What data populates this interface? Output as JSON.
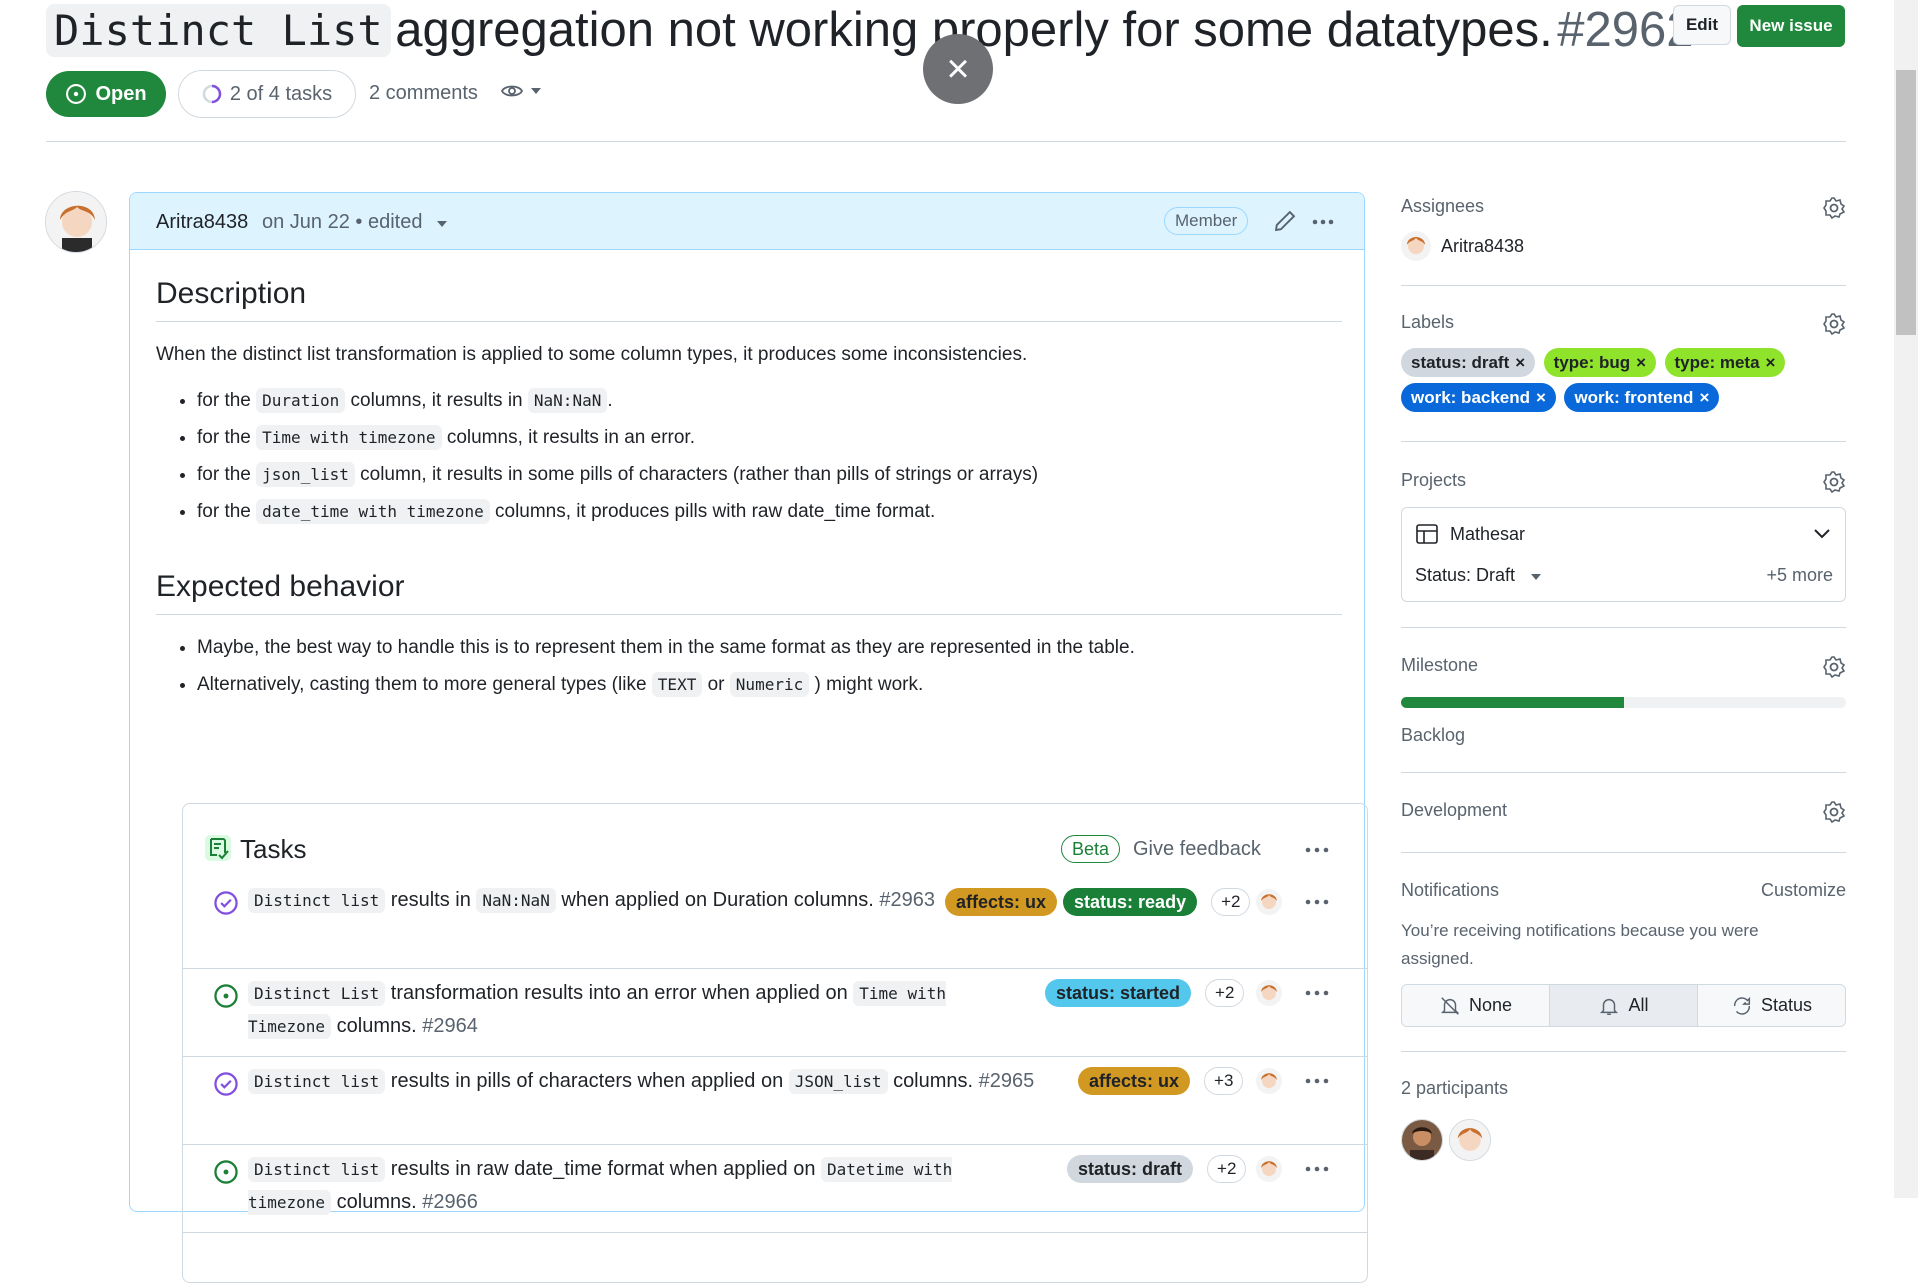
{
  "issue": {
    "title_code": "Distinct List",
    "title_rest": "aggregation not working properly for some datatypes.",
    "number": "#2962",
    "state": "Open",
    "tasks_progress": "2 of 4 tasks",
    "comments": "2 comments"
  },
  "toolbar": {
    "edit_label": "Edit",
    "new_issue_label": "New issue",
    "close_icon": "×"
  },
  "comment": {
    "author": "Aritra8438",
    "meta": "on Jun 22 • edited",
    "role": "Member",
    "description_heading": "Description",
    "description_text": "When the distinct list transformation is applied to some column types, it produces some inconsistencies.",
    "bullets": [
      {
        "pre": "for the",
        "code": "Duration",
        "mid": "columns, it results in",
        "code2": "NaN:NaN",
        "post": "."
      },
      {
        "pre": "for the",
        "code": "Time with timezone",
        "mid": "columns, it results in an error.",
        "code2": "",
        "post": ""
      },
      {
        "pre": "for the",
        "code": "json_list",
        "mid": "column, it results in some pills of characters (rather than pills of strings or arrays)",
        "code2": "",
        "post": ""
      },
      {
        "pre": "for the",
        "code": "date_time with timezone",
        "mid": "columns, it produces pills with raw date_time format.",
        "code2": "",
        "post": ""
      }
    ],
    "expected_heading": "Expected behavior",
    "expected": [
      {
        "text": "Maybe, the best way to handle this is to represent them in the same format as they are represented in the table."
      },
      {
        "pre": "Alternatively, casting them to more general types (like",
        "code": "TEXT",
        "mid": "or",
        "code2": "Numeric",
        "post": ") might work."
      }
    ]
  },
  "tasks": {
    "title": "Tasks",
    "beta": "Beta",
    "feedback": "Give feedback",
    "items": [
      {
        "code": "Distinct list",
        "text": "results in",
        "code2": "NaN:NaN",
        "text2": "when applied on Duration columns.",
        "num": "#2963",
        "state": "closed",
        "labels": [
          {
            "name": "affects: ux",
            "bg": "#d29922",
            "fg": "#1f2328"
          },
          {
            "name": "status: ready",
            "bg": "#1a7f37",
            "fg": "#ffffff"
          }
        ],
        "more": "+2"
      },
      {
        "code": "Distinct List",
        "text": "transformation results into an error when applied on",
        "code2": "Time with Timezone",
        "text2": "columns.",
        "num": "#2964",
        "state": "open",
        "labels": [
          {
            "name": "status: started",
            "bg": "#54c7ec",
            "fg": "#1f2328"
          }
        ],
        "more": "+2"
      },
      {
        "code": "Distinct list",
        "text": "results in pills of characters when applied on",
        "code2": "JSON_list",
        "text2": "columns.",
        "num": "#2965",
        "state": "closed",
        "labels": [
          {
            "name": "affects: ux",
            "bg": "#d29922",
            "fg": "#1f2328"
          }
        ],
        "more": "+3"
      },
      {
        "code": "Distinct list",
        "text": "results in raw date_time format when applied on",
        "code2": "Datetime with timezone",
        "text2": "columns.",
        "num": "#2966",
        "state": "open",
        "labels": [
          {
            "name": "status: draft",
            "bg": "#d0d7de",
            "fg": "#1f2328"
          }
        ],
        "more": "+2"
      }
    ]
  },
  "sidebar": {
    "assignees_heading": "Assignees",
    "assignee": "Aritra8438",
    "labels_heading": "Labels",
    "labels": [
      {
        "name": "status: draft",
        "bg": "#d0d7de",
        "fg": "#1f2328"
      },
      {
        "name": "type: bug",
        "bg": "#8fe32b",
        "fg": "#1f2328"
      },
      {
        "name": "type: meta",
        "bg": "#8fe32b",
        "fg": "#1f2328"
      },
      {
        "name": "work: backend",
        "bg": "#0969da",
        "fg": "#ffffff"
      },
      {
        "name": "work: frontend",
        "bg": "#0969da",
        "fg": "#ffffff"
      }
    ],
    "projects_heading": "Projects",
    "project_name": "Mathesar",
    "project_status": "Status: Draft",
    "project_more": "+5 more",
    "milestone_heading": "Milestone",
    "milestone_progress": 0.5,
    "milestone_name": "Backlog",
    "development_heading": "Development",
    "notifications_heading": "Notifications",
    "customize": "Customize",
    "notify_reason": "You’re receiving notifications because you were assigned.",
    "notify_options": [
      "None",
      "All",
      "Status"
    ],
    "participants": "2 participants"
  }
}
